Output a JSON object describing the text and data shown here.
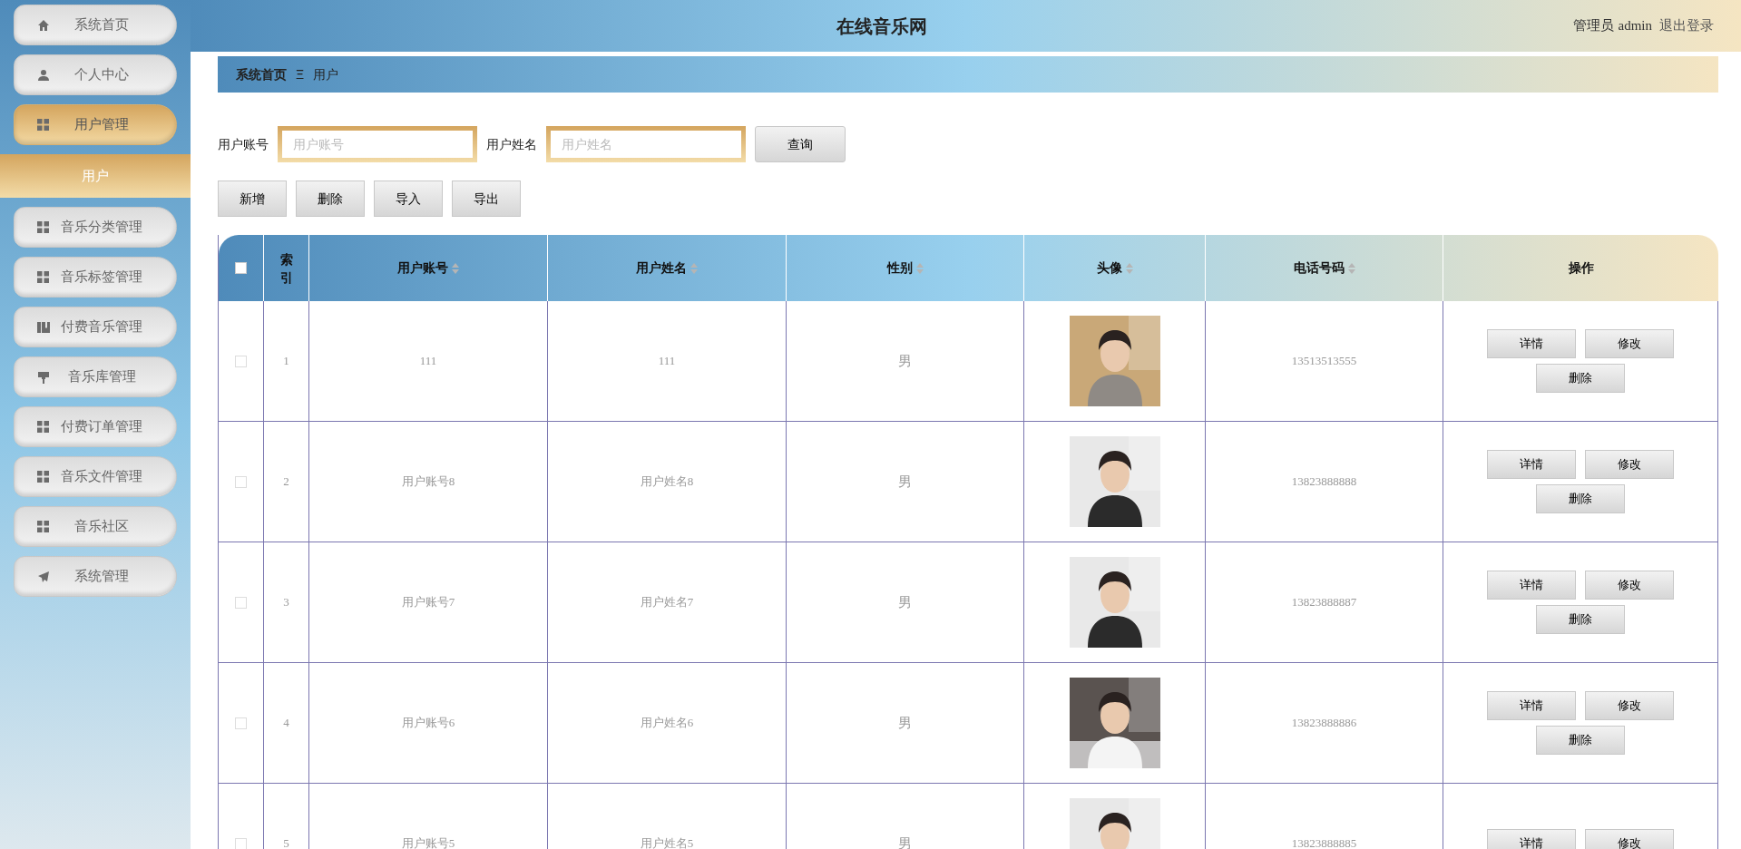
{
  "header": {
    "title": "在线音乐网",
    "role": "管理员",
    "user": "admin",
    "logout": "退出登录"
  },
  "sidebar": {
    "items": [
      {
        "label": "系统首页",
        "kind": "home",
        "selected": false
      },
      {
        "label": "个人中心",
        "kind": "user",
        "selected": false
      },
      {
        "label": "用户管理",
        "kind": "grid",
        "selected": true,
        "expanded": true,
        "children": [
          {
            "label": "用户",
            "selected": true
          }
        ]
      },
      {
        "label": "音乐分类管理",
        "kind": "grid",
        "selected": false
      },
      {
        "label": "音乐标签管理",
        "kind": "grid",
        "selected": false
      },
      {
        "label": "付费音乐管理",
        "kind": "book",
        "selected": false
      },
      {
        "label": "音乐库管理",
        "kind": "brush",
        "selected": false
      },
      {
        "label": "付费订单管理",
        "kind": "grid",
        "selected": false
      },
      {
        "label": "音乐文件管理",
        "kind": "grid",
        "selected": false
      },
      {
        "label": "音乐社区",
        "kind": "grid",
        "selected": false
      },
      {
        "label": "系统管理",
        "kind": "send",
        "selected": false
      }
    ]
  },
  "breadcrumb": {
    "home": "系统首页",
    "separator": "Ξ",
    "current": "用户"
  },
  "search": {
    "fields": [
      {
        "label": "用户账号",
        "placeholder": "用户账号"
      },
      {
        "label": "用户姓名",
        "placeholder": "用户姓名"
      }
    ],
    "button": "查询"
  },
  "actions": [
    "新增",
    "删除",
    "导入",
    "导出"
  ],
  "table": {
    "select_all": {
      "checked": false
    },
    "columns": [
      {
        "label": "索引",
        "sortable": false
      },
      {
        "label": "用户账号",
        "sortable": true
      },
      {
        "label": "用户姓名",
        "sortable": true
      },
      {
        "label": "性别",
        "sortable": true
      },
      {
        "label": "头像",
        "sortable": true
      },
      {
        "label": "电话号码",
        "sortable": true
      },
      {
        "label": "操作",
        "sortable": false
      }
    ],
    "rows": [
      {
        "checked": false,
        "index": "1",
        "account": "111",
        "name": "111",
        "gender": "男",
        "avatar": {
          "kind": "picture"
        },
        "phone": "13513513555",
        "buttons": [
          "详情",
          "修改",
          "删除"
        ]
      },
      {
        "checked": false,
        "index": "2",
        "account": "用户账号8",
        "name": "用户姓名8",
        "gender": "男",
        "avatar": {
          "kind": "picture"
        },
        "phone": "13823888888",
        "buttons": [
          "详情",
          "修改",
          "删除"
        ]
      },
      {
        "checked": false,
        "index": "3",
        "account": "用户账号7",
        "name": "用户姓名7",
        "gender": "男",
        "avatar": {
          "kind": "picture"
        },
        "phone": "13823888887",
        "buttons": [
          "详情",
          "修改",
          "删除"
        ]
      },
      {
        "checked": false,
        "index": "4",
        "account": "用户账号6",
        "name": "用户姓名6",
        "gender": "男",
        "avatar": {
          "kind": "picture"
        },
        "phone": "13823888886",
        "buttons": [
          "详情",
          "修改",
          "删除"
        ]
      },
      {
        "checked": false,
        "index": "5",
        "account": "用户账号5",
        "name": "用户姓名5",
        "gender": "男",
        "avatar": {
          "kind": "picture"
        },
        "phone": "13823888885",
        "buttons": [
          "详情",
          "修改"
        ]
      }
    ]
  }
}
